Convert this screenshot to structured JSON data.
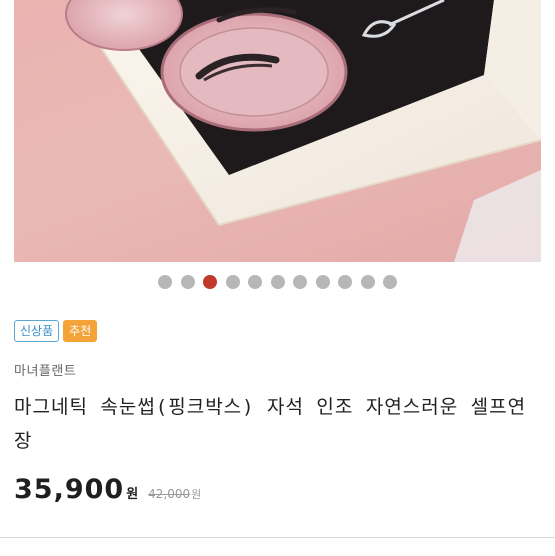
{
  "gallery": {
    "image": "pink-lash-box-photo",
    "dot_count": 11,
    "active_index": 2,
    "colors": {
      "active": "#c0392b",
      "inactive": "#b7b7b7"
    }
  },
  "badges": {
    "new": "신상품",
    "recommend": "추천"
  },
  "product": {
    "brand": "마녀플랜트",
    "title": "마그네틱 속눈썹(핑크박스) 자석 인조 자연스러운 셀프연장",
    "price": "35,900",
    "price_unit": "원",
    "original_price": "42,000",
    "original_unit": "원"
  }
}
